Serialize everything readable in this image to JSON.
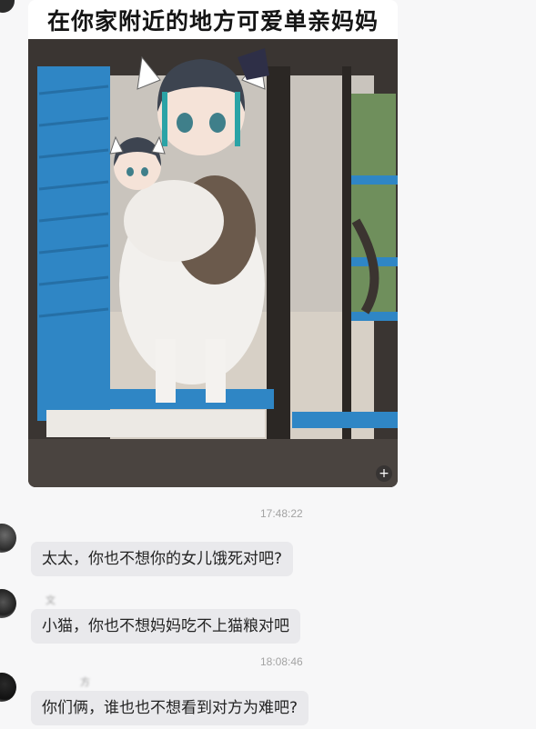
{
  "meme": {
    "caption": "在你家附近的地方可爱单亲妈妈",
    "expand_glyph": "+"
  },
  "messages": [
    {
      "timestamp": "17:48:22",
      "sender": "  ",
      "text": "太太，你也不想你的女儿饿死对吧?"
    },
    {
      "timestamp": "",
      "sender": "文",
      "text": "小猫，你也不想妈妈吃不上猫粮对吧"
    },
    {
      "timestamp": "18:08:46",
      "sender": "方",
      "text": "你们俩，谁也也不想看到对方为难吧?"
    }
  ],
  "colors": {
    "background": "#f7f7f8",
    "bubble": "#e9e9ec",
    "timestamp": "#a3a3a3",
    "blue_wall": "#2f86c5"
  }
}
